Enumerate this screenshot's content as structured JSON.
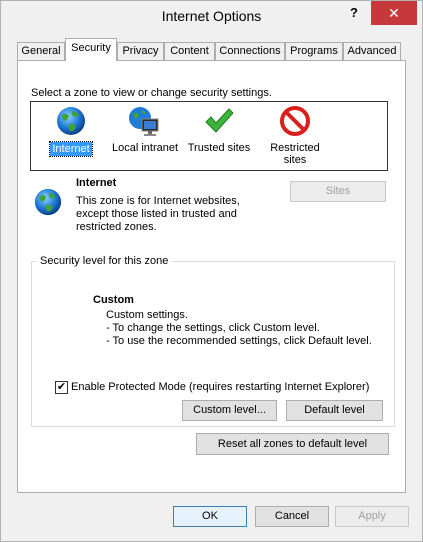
{
  "window": {
    "title": "Internet Options",
    "help_label": "?",
    "close_label": "✕"
  },
  "tabs": [
    {
      "label": "General"
    },
    {
      "label": "Security",
      "active": true
    },
    {
      "label": "Privacy"
    },
    {
      "label": "Content"
    },
    {
      "label": "Connections"
    },
    {
      "label": "Programs"
    },
    {
      "label": "Advanced"
    }
  ],
  "zones_section": {
    "instruction": "Select a zone to view or change security settings.",
    "zones": [
      {
        "label": "Internet",
        "icon": "globe-icon",
        "selected": true
      },
      {
        "label": "Local intranet",
        "icon": "intranet-icon"
      },
      {
        "label": "Trusted sites",
        "icon": "checkmark-icon"
      },
      {
        "label_line1": "Restricted",
        "label_line2": "sites",
        "icon": "restricted-icon"
      }
    ]
  },
  "zone_info": {
    "name": "Internet",
    "description_lines": [
      "This zone is for Internet websites,",
      "except those listed in trusted and",
      "restricted zones."
    ],
    "sites_button": "Sites"
  },
  "security_level": {
    "group_title": "Security level for this zone",
    "level_name": "Custom",
    "lines": [
      "Custom settings.",
      "- To change the settings, click Custom level.",
      "- To use the recommended settings, click Default level."
    ],
    "protected_mode_label": "Enable Protected Mode (requires restarting Internet Explorer)",
    "protected_mode_checked": "✔",
    "custom_level_button": "Custom level...",
    "default_level_button": "Default level"
  },
  "reset_button": "Reset all zones to default level",
  "footer": {
    "ok": "OK",
    "cancel": "Cancel",
    "apply": "Apply"
  },
  "colors": {
    "selection": "#3399ff",
    "close_button": "#c7383b"
  }
}
